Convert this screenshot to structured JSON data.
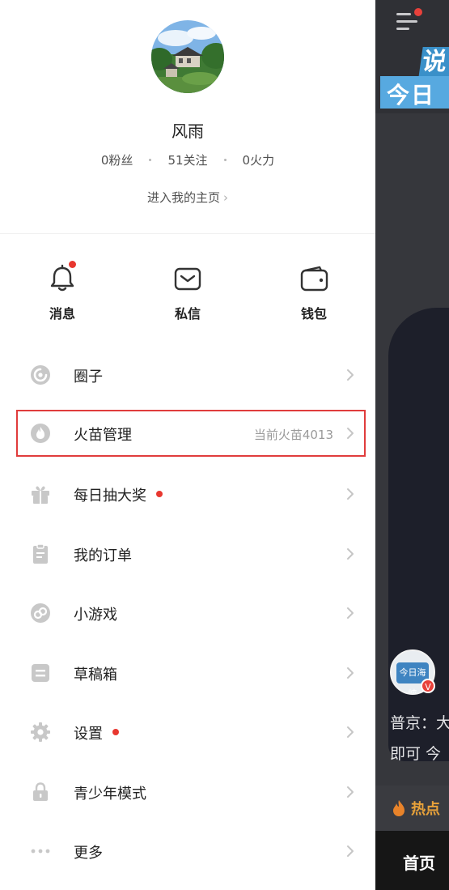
{
  "profile": {
    "name": "风雨",
    "stats": [
      {
        "value": "0",
        "label": "粉丝"
      },
      {
        "value": "51",
        "label": "关注"
      },
      {
        "value": "0",
        "label": "火力"
      }
    ],
    "homepage_link": "进入我的主页"
  },
  "quick_actions": [
    {
      "label": "消息",
      "icon": "bell-icon",
      "has_dot": true
    },
    {
      "label": "私信",
      "icon": "mail-icon",
      "has_dot": false
    },
    {
      "label": "钱包",
      "icon": "wallet-icon",
      "has_dot": false
    }
  ],
  "menu": [
    {
      "label": "圈子",
      "icon": "circle-icon"
    },
    {
      "label": "火苗管理",
      "icon": "flame-icon",
      "value": "当前火苗4013",
      "highlighted": true
    },
    {
      "label": "每日抽大奖",
      "icon": "gift-icon",
      "has_dot": true
    },
    {
      "label": "我的订单",
      "icon": "clipboard-icon"
    },
    {
      "label": "小游戏",
      "icon": "game-icon"
    },
    {
      "label": "草稿箱",
      "icon": "draft-icon"
    },
    {
      "label": "设置",
      "icon": "gear-icon",
      "has_dot": true
    },
    {
      "label": "青少年模式",
      "icon": "lock-icon"
    },
    {
      "label": "更多",
      "icon": "more-icon"
    }
  ],
  "background": {
    "banner_top": "说",
    "banner": "今日",
    "avatar_text": "今日海峡",
    "verified_mark": "V",
    "caption_line1": "普京：大",
    "caption_line2": "即可 今",
    "hot_label": "热点",
    "tab_home": "首页"
  },
  "colors": {
    "accent_red": "#e8372f",
    "highlight_border": "#e03c3c",
    "icon_gray": "#c8c8c8"
  }
}
